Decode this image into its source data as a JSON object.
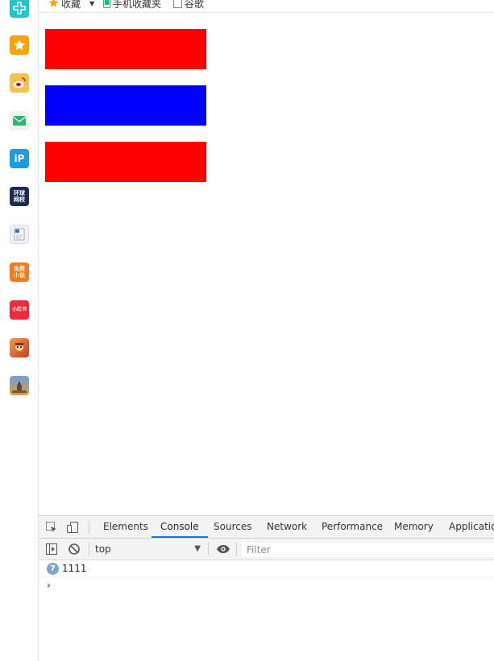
{
  "bookmarks": {
    "items": [
      {
        "label": "收藏",
        "icon": "star-icon"
      },
      {
        "label": "手机收藏夹",
        "icon": "phone-icon"
      },
      {
        "label": "谷歌",
        "icon": "page-icon"
      }
    ]
  },
  "rail": {
    "apps": [
      {
        "name": "plus-app-icon",
        "color": "#1fc7c8",
        "text": ""
      },
      {
        "name": "favorites-star-icon",
        "color": "#f7a400",
        "text": "★"
      },
      {
        "name": "weibo-icon",
        "color": "#f5b332",
        "text": ""
      },
      {
        "name": "mail-icon",
        "color": "#2bb673",
        "text": ""
      },
      {
        "name": "ip-app-icon",
        "color": "#1b9be0",
        "text": "iP"
      },
      {
        "name": "news-app-icon",
        "color": "#1c2b4f",
        "text": "环球 网校"
      },
      {
        "name": "word-doc-icon",
        "color": "#e9eef7",
        "text": "W"
      },
      {
        "name": "free-novel-icon",
        "color": "#f57a1c",
        "text": "免费 小说"
      },
      {
        "name": "xiaohongshu-icon",
        "color": "#f0283c",
        "text": "小红书"
      },
      {
        "name": "game-character-icon",
        "color": "#d8573a",
        "text": ""
      },
      {
        "name": "game-scene-icon",
        "color": "#4b6a8a",
        "text": ""
      }
    ]
  },
  "page": {
    "boxes": [
      {
        "name": "red-box-1",
        "color": "#ff0000"
      },
      {
        "name": "blue-box",
        "color": "#0000ff"
      },
      {
        "name": "red-box-2",
        "color": "#ff0000"
      }
    ]
  },
  "devtools": {
    "tabs": [
      "Elements",
      "Console",
      "Sources",
      "Network",
      "Performance",
      "Memory",
      "Application"
    ],
    "active_tab": "Console",
    "context": "top",
    "filter_placeholder": "Filter",
    "log": {
      "count": "7",
      "text": "1111"
    },
    "prompt": "›"
  }
}
